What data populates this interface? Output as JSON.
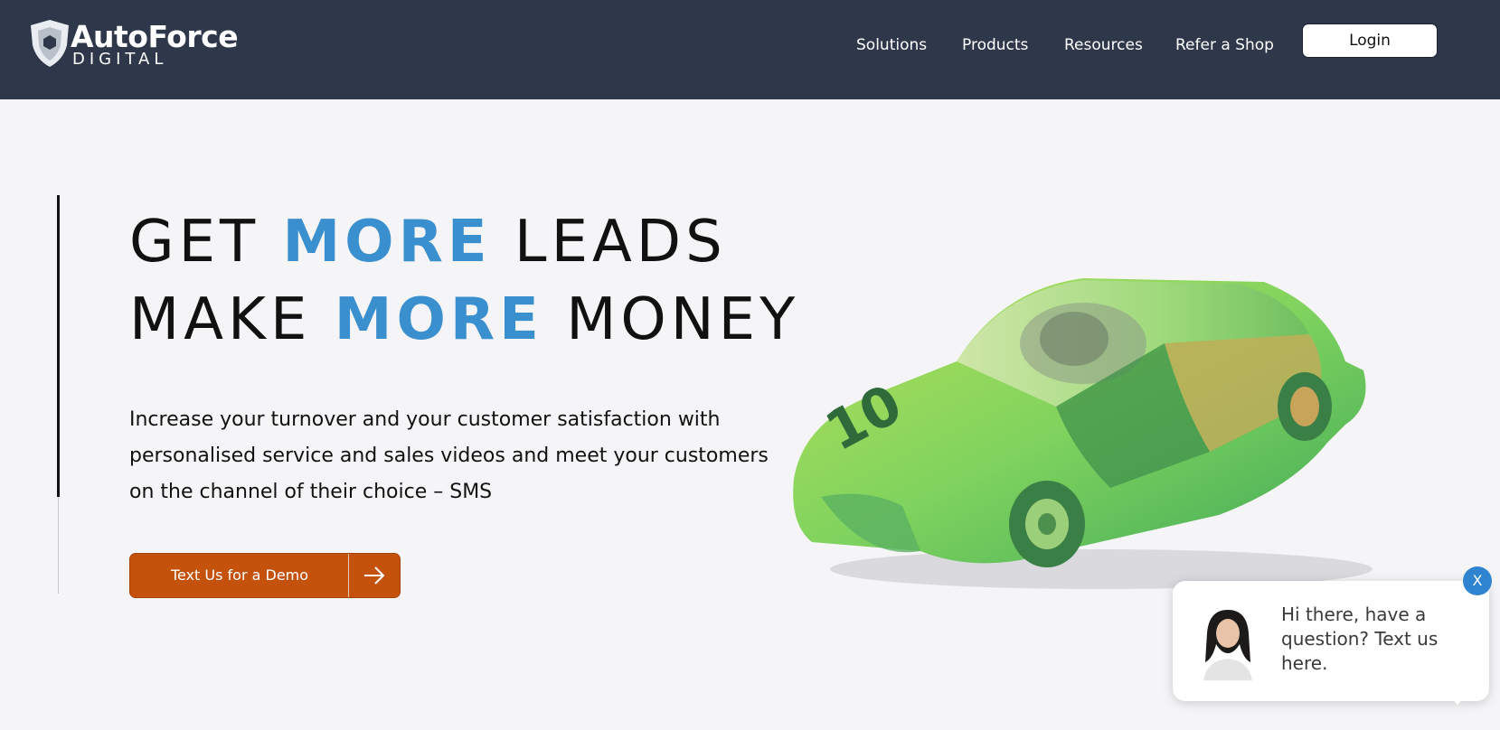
{
  "colors": {
    "header_bg": "#2e384a",
    "page_bg": "#f5f5f7",
    "accent_blue": "#3a8fcf",
    "cta_orange": "#c4520c",
    "chat_close_blue": "#2f84cf"
  },
  "header": {
    "logo": {
      "name": "AutoForce",
      "sub": "DIGITAL",
      "icon": "shield-logo-icon"
    },
    "nav": [
      "Solutions",
      "Products",
      "Resources",
      "Refer a Shop"
    ],
    "login_label": "Login"
  },
  "hero": {
    "line1": {
      "pre": "GET ",
      "highlight": "MORE",
      "post": " LEADS"
    },
    "line2": {
      "pre": "MAKE ",
      "highlight": "MORE",
      "post": " MONEY"
    },
    "description": "Increase your turnover and your customer satisfaction with personalised service and sales videos and meet your customers on the channel of their choice – SMS",
    "cta_label": "Text Us for a Demo",
    "cta_icon": "arrow-right-icon",
    "image": "banknote-car-image"
  },
  "chat_widget": {
    "message": "Hi there, have a question? Text us here.",
    "close_label": "X",
    "avatar": "agent-avatar"
  }
}
